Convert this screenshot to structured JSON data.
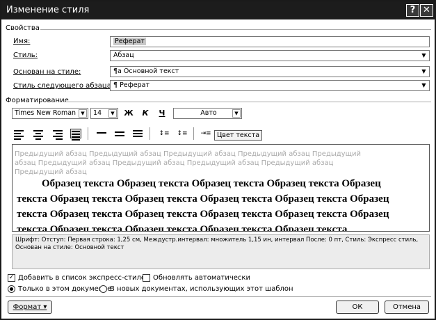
{
  "window": {
    "title": "Изменение стиля",
    "help_label": "?",
    "close_label": "✕"
  },
  "properties": {
    "group_label": "Свойства",
    "name_label": "Имя:",
    "name_value": "Реферат",
    "style_label": "Стиль:",
    "style_value": "Абзац",
    "based_label": "Основан на стиле:",
    "based_value": "¶a Основной текст",
    "next_label": "Стиль следующего абзаца:",
    "next_value": "¶ Реферат"
  },
  "formatting": {
    "group_label": "Форматирование",
    "font": "Times New Roman",
    "size": "14",
    "bold": "Ж",
    "italic": "К",
    "underline": "Ч",
    "color": "Авто",
    "tooltip": "Цвет текста"
  },
  "preview": {
    "previous_paragraph": "Предыдущий абзац Предыдущий абзац Предыдущий абзац Предыдущий абзац Предыдущий абзац Предыдущий абзац Предыдущий абзац Предыдущий абзац Предыдущий абзац Предыдущий абзац",
    "sample_text": "Образец текста Образец текста Образец текста Образец текста Образец текста Образец текста Образец текста Образец текста Образец текста Образец текста Образец текста Образец текста Образец текста Образец текста Образец текста Образец текста Образец текста Образец текста Образец текста"
  },
  "description": "Шрифт: Отступ: Первая строка: 1,25 см, Междустр.интервал: множитель 1,15 ин, интервал После: 0 пт, Стиль: Экспресс стиль, Основан на стиле: Основной текст",
  "options": {
    "add_quick": "Добавить в список экспресс-стилей",
    "add_quick_checked": true,
    "auto_update": "Обновлять автоматически",
    "auto_update_checked": false,
    "only_this_doc": "Только в этом документе",
    "new_docs": "В новых документах, использующих этот шаблон",
    "selected_scope": "only_this_doc"
  },
  "buttons": {
    "format": "Формат ▾",
    "ok": "ОК",
    "cancel": "Отмена"
  }
}
